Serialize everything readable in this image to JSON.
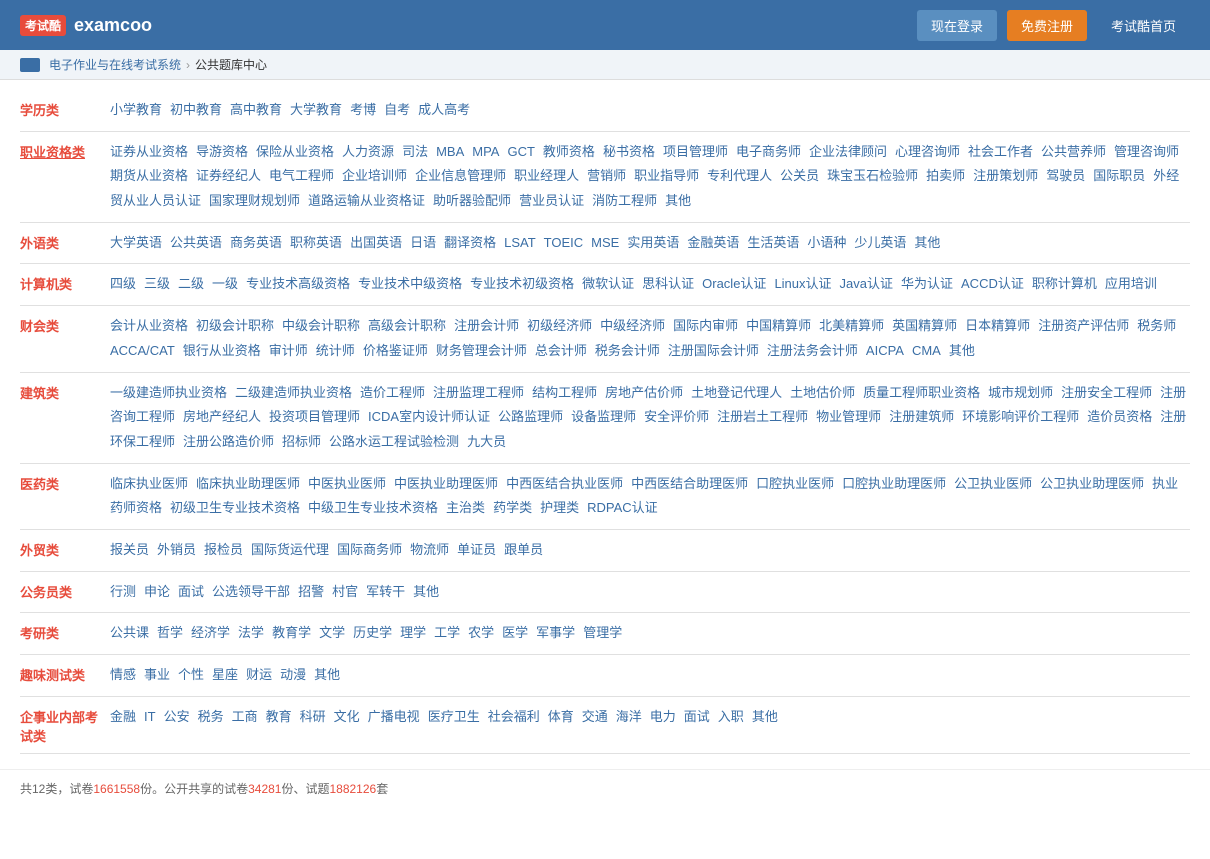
{
  "header": {
    "logo_icon": "考试酷",
    "logo_text": "examcoo",
    "btn_login": "现在登录",
    "btn_register": "免费注册",
    "btn_home": "考试酷首页"
  },
  "breadcrumb": {
    "item1": "电子作业与在线考试系统",
    "item2": "公共题库中心"
  },
  "categories": [
    {
      "label": "学历类",
      "underline": false,
      "links": [
        "小学教育",
        "初中教育",
        "高中教育",
        "大学教育",
        "考博",
        "自考",
        "成人高考"
      ]
    },
    {
      "label": "职业资格类",
      "underline": true,
      "links": [
        "证券从业资格",
        "导游资格",
        "保险从业资格",
        "人力资源",
        "司法",
        "MBA",
        "MPA",
        "GCT",
        "教师资格",
        "秘书资格",
        "项目管理师",
        "电子商务师",
        "企业法律顾问",
        "心理咨询师",
        "社会工作者",
        "公共营养师",
        "管理咨询师",
        "期货从业资格",
        "证券经纪人",
        "电气工程师",
        "企业培训师",
        "企业信息管理师",
        "职业经理人",
        "营销师",
        "职业指导师",
        "专利代理人",
        "公关员",
        "珠宝玉石检验师",
        "拍卖师",
        "注册策划师",
        "驾驶员",
        "国际职员",
        "外经贸从业人员认证",
        "国家理财规划师",
        "道路运输从业资格证",
        "助听器验配师",
        "营业员认证",
        "消防工程师",
        "其他"
      ]
    },
    {
      "label": "外语类",
      "underline": false,
      "links": [
        "大学英语",
        "公共英语",
        "商务英语",
        "职称英语",
        "出国英语",
        "日语",
        "翻译资格",
        "LSAT",
        "TOEIC",
        "MSE",
        "实用英语",
        "金融英语",
        "生活英语",
        "小语种",
        "少儿英语",
        "其他"
      ]
    },
    {
      "label": "计算机类",
      "underline": false,
      "links": [
        "四级",
        "三级",
        "二级",
        "一级",
        "专业技术高级资格",
        "专业技术中级资格",
        "专业技术初级资格",
        "微软认证",
        "思科认证",
        "Oracle认证",
        "Linux认证",
        "Java认证",
        "华为认证",
        "ACCD认证",
        "职称计算机",
        "应用培训"
      ]
    },
    {
      "label": "财会类",
      "underline": false,
      "links": [
        "会计从业资格",
        "初级会计职称",
        "中级会计职称",
        "高级会计职称",
        "注册会计师",
        "初级经济师",
        "中级经济师",
        "国际内审师",
        "中国精算师",
        "北美精算师",
        "英国精算师",
        "日本精算师",
        "注册资产评估师",
        "税务师",
        "ACCA/CAT",
        "银行从业资格",
        "审计师",
        "统计师",
        "价格鉴证师",
        "财务管理会计师",
        "总会计师",
        "税务会计师",
        "注册国际会计师",
        "注册法务会计师",
        "AICPA",
        "CMA",
        "其他"
      ]
    },
    {
      "label": "建筑类",
      "underline": false,
      "links": [
        "一级建造师执业资格",
        "二级建造师执业资格",
        "造价工程师",
        "注册监理工程师",
        "结构工程师",
        "房地产估价师",
        "土地登记代理人",
        "土地估价师",
        "质量工程师职业资格",
        "城市规划师",
        "注册安全工程师",
        "注册咨询工程师",
        "房地产经纪人",
        "投资项目管理师",
        "ICDA室内设计师认证",
        "公路监理师",
        "设备监理师",
        "安全评价师",
        "注册岩土工程师",
        "物业管理师",
        "注册建筑师",
        "环境影响评价工程师",
        "造价员资格",
        "注册环保工程师",
        "注册公路造价师",
        "招标师",
        "公路水运工程试验检测",
        "九大员"
      ]
    },
    {
      "label": "医药类",
      "underline": false,
      "links": [
        "临床执业医师",
        "临床执业助理医师",
        "中医执业医师",
        "中医执业助理医师",
        "中西医结合执业医师",
        "中西医结合助理医师",
        "口腔执业医师",
        "口腔执业助理医师",
        "公卫执业医师",
        "公卫执业助理医师",
        "执业药师资格",
        "初级卫生专业技术资格",
        "中级卫生专业技术资格",
        "主治类",
        "药学类",
        "护理类",
        "RDPAC认证"
      ]
    },
    {
      "label": "外贸类",
      "underline": false,
      "links": [
        "报关员",
        "外销员",
        "报检员",
        "国际货运代理",
        "国际商务师",
        "物流师",
        "单证员",
        "跟单员"
      ]
    },
    {
      "label": "公务员类",
      "underline": false,
      "links": [
        "行测",
        "申论",
        "面试",
        "公选领导干部",
        "招警",
        "村官",
        "军转干",
        "其他"
      ]
    },
    {
      "label": "考研类",
      "underline": false,
      "links": [
        "公共课",
        "哲学",
        "经济学",
        "法学",
        "教育学",
        "文学",
        "历史学",
        "理学",
        "工学",
        "农学",
        "医学",
        "军事学",
        "管理学"
      ]
    },
    {
      "label": "趣味测试类",
      "underline": false,
      "links": [
        "情感",
        "事业",
        "个性",
        "星座",
        "财运",
        "动漫",
        "其他"
      ]
    },
    {
      "label": "企事业内部考试类",
      "underline": false,
      "links": [
        "金融",
        "IT",
        "公安",
        "税务",
        "工商",
        "教育",
        "科研",
        "文化",
        "广播电视",
        "医疗卫生",
        "社会福利",
        "体育",
        "交通",
        "海洋",
        "电力",
        "面试",
        "入职",
        "其他"
      ]
    }
  ],
  "footer": {
    "total_text": "共12类，试卷",
    "total_count": "1661558",
    "total_text2": "份。公开共享的试卷",
    "share_count": "34281",
    "total_text3": "份、试题",
    "question_count": "1882126",
    "total_text4": "套"
  }
}
